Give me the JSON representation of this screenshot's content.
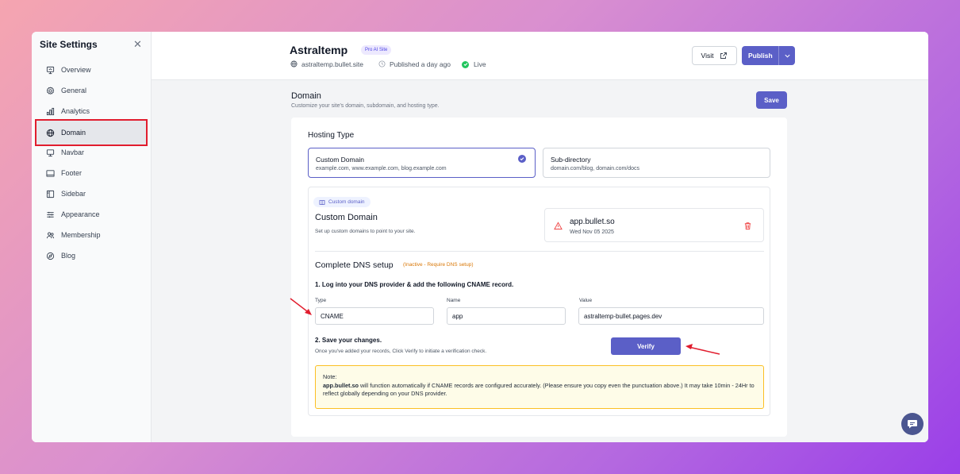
{
  "sidebar": {
    "title": "Site Settings",
    "close_icon": "close-icon",
    "items": [
      {
        "label": "Overview",
        "icon": "presentation-icon"
      },
      {
        "label": "General",
        "icon": "gear-icon"
      },
      {
        "label": "Analytics",
        "icon": "bar-chart-icon"
      },
      {
        "label": "Domain",
        "icon": "globe-icon",
        "active": true
      },
      {
        "label": "Navbar",
        "icon": "navbar-icon"
      },
      {
        "label": "Footer",
        "icon": "footer-icon"
      },
      {
        "label": "Sidebar",
        "icon": "sidebar-icon"
      },
      {
        "label": "Appearance",
        "icon": "sliders-icon"
      },
      {
        "label": "Membership",
        "icon": "users-icon"
      },
      {
        "label": "Blog",
        "icon": "blog-icon"
      }
    ]
  },
  "header": {
    "site_name": "Astraltemp",
    "badge": "Pro AI Site",
    "url": "astraltemp.bullet.site",
    "published": "Published a day ago",
    "status": "Live",
    "visit_label": "Visit",
    "publish_label": "Publish"
  },
  "section": {
    "title": "Domain",
    "subtitle": "Customize your site's domain, subdomain, and hosting type.",
    "save_label": "Save"
  },
  "hosting": {
    "title": "Hosting Type",
    "options": [
      {
        "title": "Custom Domain",
        "desc": "example.com, www.example.com, blog.example.com",
        "selected": true
      },
      {
        "title": "Sub-directory",
        "desc": "domain.com/blog, domain.com/docs",
        "selected": false
      }
    ]
  },
  "custom_domain": {
    "chip": "Custom domain",
    "title": "Custom Domain",
    "subtitle": "Set up custom domains to point to your site.",
    "domain_name": "app.bullet.so",
    "domain_date": "Wed Nov 05 2025"
  },
  "dns": {
    "title": "Complete DNS setup",
    "status": "(Inactive - Require DNS setup)",
    "step1": "1. Log into your DNS provider & add the following CNAME record.",
    "type_label": "Type",
    "type_value": "CNAME",
    "name_label": "Name",
    "name_value": "app",
    "value_label": "Value",
    "value_value": "astraltemp-bullet.pages.dev",
    "step2": "2. Save your changes.",
    "step2_sub": "Once you've added your records, Click Verify to initiate a verification check.",
    "verify_label": "Verify"
  },
  "note": {
    "heading": "Note:",
    "domain": "app.bullet.so",
    "text": " will function automatically if CNAME records are configured accurately. (Please ensure you copy even the punctuation above.) It may take 10min - 24Hr to reflect globally depending on your DNS provider."
  },
  "colors": {
    "accent": "#5b5fc7",
    "highlight": "#e11d2e",
    "warning": "#d97706",
    "live": "#22c55e"
  }
}
